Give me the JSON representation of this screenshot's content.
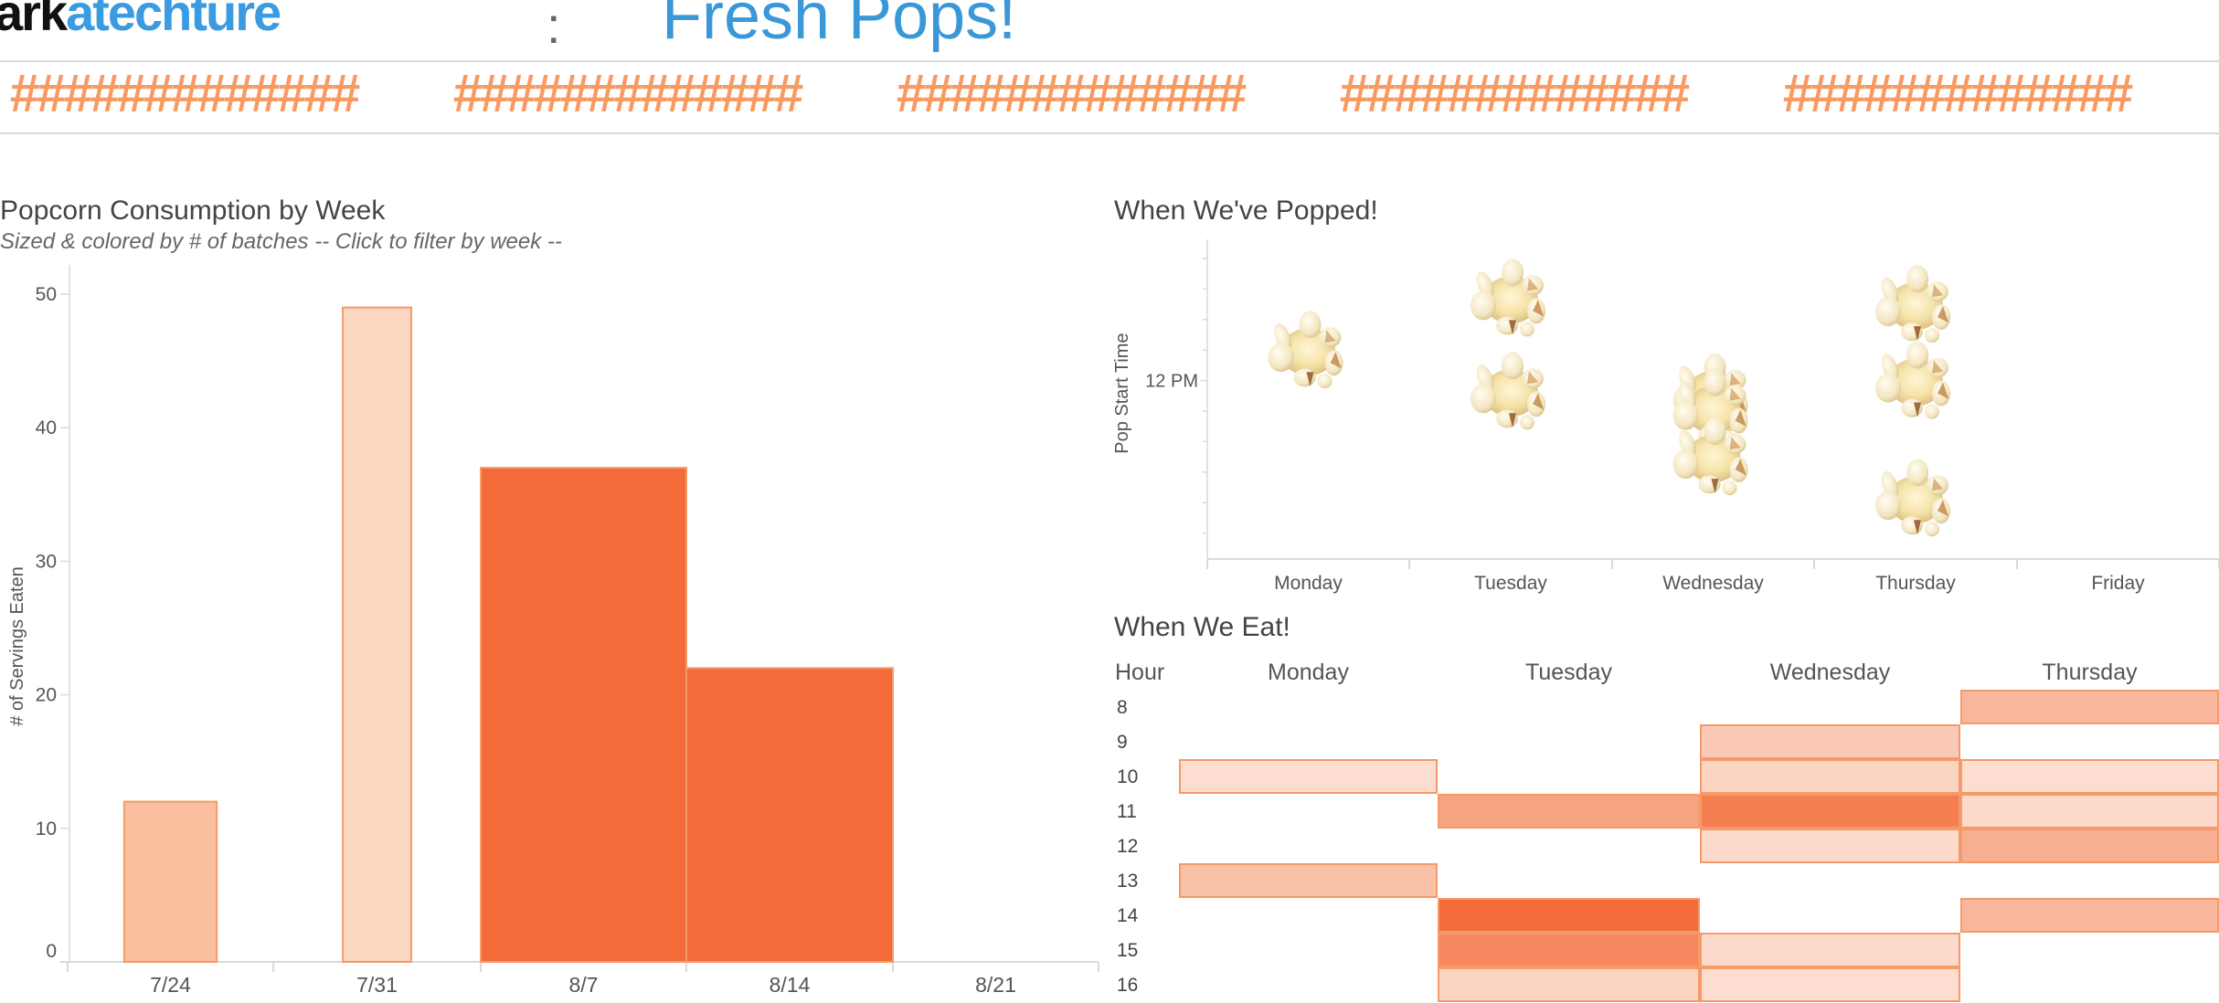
{
  "header": {
    "logo_dark": "ark",
    "logo_blue": "atechture",
    "separator": ":",
    "title": "Fresh Pops!",
    "placeholder_groups": [
      "#############",
      "#############",
      "#############",
      "#############",
      "#############"
    ]
  },
  "colors": {
    "accent_blue": "#3a97d8",
    "orange_dark": "#f26b38",
    "orange_border": "#f59a68",
    "gridline": "#d9d9d9"
  },
  "bar_panel": {
    "title": "Popcorn Consumption by Week",
    "subtitle": "Sized & colored by # of batches -- Click to filter by week  --"
  },
  "scatter_panel": {
    "title": "When We've Popped!"
  },
  "heatmap_panel": {
    "title": "When We Eat!",
    "hour_header": "Hour"
  },
  "chart_data": [
    {
      "type": "bar",
      "title": "Popcorn Consumption by Week",
      "subtitle": "Sized & colored by # of batches -- Click to filter by week  --",
      "xlabel": "",
      "ylabel": "# of Servings Eaten",
      "categories": [
        "7/24",
        "7/31",
        "8/7",
        "8/14",
        "8/21"
      ],
      "values": [
        12,
        49,
        37,
        22,
        null
      ],
      "batches_relative_width": [
        0.45,
        0.33,
        1.0,
        1.0,
        0
      ],
      "fill_colors": [
        "#f9bf9e",
        "#fbd6c1",
        "#f26b38",
        "#f26b38",
        null
      ],
      "ylim": [
        0,
        52
      ],
      "yticks": [
        0,
        10,
        20,
        30,
        40,
        50
      ],
      "grid": false,
      "legend": "none"
    },
    {
      "type": "scatter",
      "title": "When We've Popped!",
      "xlabel": "",
      "ylabel": "Pop Start Time",
      "categories": [
        "Monday",
        "Tuesday",
        "Wednesday",
        "Thursday",
        "Friday"
      ],
      "y_unit": "hour of day",
      "ylim": [
        7.35,
        17.85
      ],
      "ytick_labels": [
        {
          "value": 12,
          "label": "12 PM"
        }
      ],
      "yminor_ticks": [
        8,
        9,
        10,
        11,
        13,
        14,
        15,
        16,
        17
      ],
      "marker": "popcorn-image",
      "points": [
        {
          "day": "Monday",
          "hour": 11.0
        },
        {
          "day": "Tuesday",
          "hour": 9.3
        },
        {
          "day": "Tuesday",
          "hour": 12.35
        },
        {
          "day": "Wednesday",
          "hour": 12.4
        },
        {
          "day": "Wednesday",
          "hour": 12.9
        },
        {
          "day": "Wednesday",
          "hour": 14.5
        },
        {
          "day": "Thursday",
          "hour": 9.5
        },
        {
          "day": "Thursday",
          "hour": 12.0
        },
        {
          "day": "Thursday",
          "hour": 15.85
        }
      ],
      "legend": "none"
    },
    {
      "type": "heatmap",
      "title": "When We Eat!",
      "row_header": "Hour",
      "rows": [
        8,
        9,
        10,
        11,
        12,
        13,
        14,
        15,
        16
      ],
      "columns": [
        "Monday",
        "Tuesday",
        "Wednesday",
        "Thursday"
      ],
      "value_range": [
        0,
        7
      ],
      "cells": [
        {
          "hour": 8,
          "day": "Thursday",
          "value": 3
        },
        {
          "hour": 9,
          "day": "Wednesday",
          "value": 2
        },
        {
          "hour": 10,
          "day": "Monday",
          "value": 1
        },
        {
          "hour": 10,
          "day": "Wednesday",
          "value": 1.5
        },
        {
          "hour": 10,
          "day": "Thursday",
          "value": 1
        },
        {
          "hour": 11,
          "day": "Tuesday",
          "value": 4
        },
        {
          "hour": 11,
          "day": "Wednesday",
          "value": 6
        },
        {
          "hour": 11,
          "day": "Thursday",
          "value": 1.2
        },
        {
          "hour": 12,
          "day": "Wednesday",
          "value": 1.2
        },
        {
          "hour": 12,
          "day": "Thursday",
          "value": 3.5
        },
        {
          "hour": 13,
          "day": "Monday",
          "value": 2.5
        },
        {
          "hour": 14,
          "day": "Tuesday",
          "value": 7
        },
        {
          "hour": 14,
          "day": "Thursday",
          "value": 3
        },
        {
          "hour": 15,
          "day": "Tuesday",
          "value": 5.5
        },
        {
          "hour": 15,
          "day": "Wednesday",
          "value": 1.2
        },
        {
          "hour": 16,
          "day": "Tuesday",
          "value": 1.5
        },
        {
          "hour": 16,
          "day": "Wednesday",
          "value": 1
        }
      ],
      "legend": "none"
    }
  ]
}
